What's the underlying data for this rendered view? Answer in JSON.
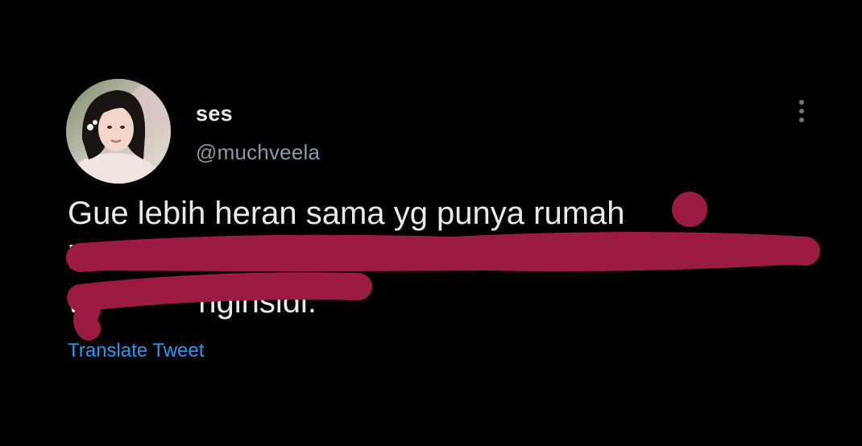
{
  "tweet": {
    "display_name": "ses",
    "handle": "@muchveela",
    "text_lines": [
      "Gue lebih heran sama yg punya rumah",
      "l",
      "w            nginsidi."
    ],
    "translate_label": "Translate Tweet",
    "more_icon": "more-vertical-icon",
    "avatar_icon": "avatar"
  },
  "colors": {
    "background": "#000000",
    "text": "#e7e9ea",
    "secondary": "#8b98a5",
    "link": "#1d9bf0",
    "redaction": "#9b1b43"
  }
}
